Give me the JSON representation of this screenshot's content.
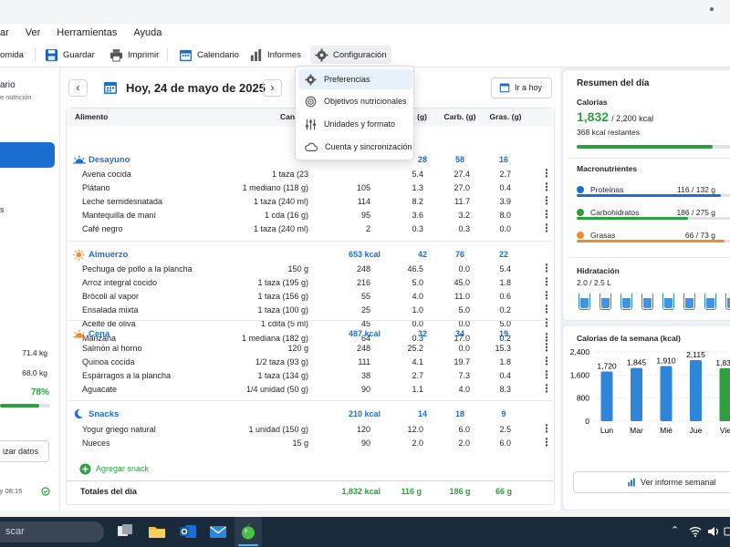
{
  "menu": {
    "archivo": "ar",
    "ver": "Ver",
    "herramientas": "Herramientas",
    "ayuda": "Ayuda"
  },
  "toolbar": {
    "comida": "omida",
    "guardar": "Guardar",
    "imprimir": "Imprimir",
    "calendario": "Calendario",
    "informes": "Informes",
    "configuracion": "Configuración"
  },
  "dropdown": [
    "Preferencias",
    "Objetivos nutricionales",
    "Unidades y formato",
    "Cuenta y sincronización"
  ],
  "sidebar": {
    "title": "ario",
    "subtitle": "e nutrición",
    "letter": "s",
    "w1": "71.4 kg",
    "w2": "68.0 kg",
    "progress_pct": "78%",
    "progress": 0.78,
    "sync_btn": "izar datos",
    "last_sync": "ación: Hoy 08:15"
  },
  "date_nav": {
    "date": "Hoy, 24 de mayo de 2025",
    "today_btn": "Ir a hoy"
  },
  "table": {
    "headers": [
      "Alimento",
      "Can",
      ". (g)",
      "Carb. (g)",
      "Gras. (g)"
    ],
    "meals": [
      {
        "name": "Desayuno",
        "kcal": "",
        "p": "28",
        "c": "58",
        "g": "16",
        "items": [
          {
            "food": "Avena cocida",
            "qty": "1 taza (23",
            "kcal": "",
            "p": "5.4",
            "c": "27.4",
            "g": "2.7"
          },
          {
            "food": "Plátano",
            "qty": "1 mediano (118 g)",
            "kcal": "105",
            "p": "1.3",
            "c": "27.0",
            "g": "0.4"
          },
          {
            "food": "Leche semidesnatada",
            "qty": "1 taza (240 ml)",
            "kcal": "114",
            "p": "8.2",
            "c": "11.7",
            "g": "3.9"
          },
          {
            "food": "Mantequilla de maní",
            "qty": "1 cda (16 g)",
            "kcal": "95",
            "p": "3.6",
            "c": "3.2",
            "g": "8.0"
          },
          {
            "food": "Café negro",
            "qty": "1 taza (240 ml)",
            "kcal": "2",
            "p": "0.3",
            "c": "0.3",
            "g": "0.0"
          }
        ]
      },
      {
        "name": "Almuerzo",
        "kcal": "653 kcal",
        "p": "42",
        "c": "76",
        "g": "22",
        "items": [
          {
            "food": "Pechuga de pollo a la plancha",
            "qty": "150 g",
            "kcal": "248",
            "p": "46.5",
            "c": "0.0",
            "g": "5.4"
          },
          {
            "food": "Arroz integral cocido",
            "qty": "1 taza (195 g)",
            "kcal": "216",
            "p": "5.0",
            "c": "45.0",
            "g": "1.8"
          },
          {
            "food": "Brócoli al vapor",
            "qty": "1 taza (156 g)",
            "kcal": "55",
            "p": "4.0",
            "c": "11.0",
            "g": "0.6"
          },
          {
            "food": "Ensalada mixta",
            "qty": "1 taza (100 g)",
            "kcal": "25",
            "p": "1.0",
            "c": "5.0",
            "g": "0.2"
          },
          {
            "food": "Aceite de oliva",
            "qty": "1 cdita (5 ml)",
            "kcal": "45",
            "p": "0.0",
            "c": "0.0",
            "g": "5.0"
          },
          {
            "food": "Manzana",
            "qty": "1 mediana (182 g)",
            "kcal": "64",
            "p": "0.3",
            "c": "17.0",
            "g": "0.2"
          }
        ]
      },
      {
        "name": "Cena",
        "kcal": "487 kcal",
        "p": "32",
        "c": "34",
        "g": "19",
        "items": [
          {
            "food": "Salmón al horno",
            "qty": "120 g",
            "kcal": "248",
            "p": "25.2",
            "c": "0.0",
            "g": "15.3"
          },
          {
            "food": "Quinoa cocida",
            "qty": "1/2 taza (93 g)",
            "kcal": "111",
            "p": "4.1",
            "c": "19.7",
            "g": "1.8"
          },
          {
            "food": "Espárragos a la plancha",
            "qty": "1 taza (134 g)",
            "kcal": "38",
            "p": "2.7",
            "c": "7.3",
            "g": "0.4"
          },
          {
            "food": "Aguacate",
            "qty": "1/4 unidad (50 g)",
            "kcal": "90",
            "p": "1.1",
            "c": "4.0",
            "g": "8.3"
          }
        ]
      },
      {
        "name": "Snacks",
        "kcal": "210 kcal",
        "p": "14",
        "c": "18",
        "g": "9",
        "items": [
          {
            "food": "Yogur griego natural",
            "qty": "1 unidad (150 g)",
            "kcal": "120",
            "p": "12.0",
            "c": "6.0",
            "g": "2.5"
          },
          {
            "food": "Nueces",
            "qty": "15 g",
            "kcal": "90",
            "p": "2.0",
            "c": "2.0",
            "g": "6.0"
          }
        ]
      }
    ],
    "add_snack": "Agregar snack",
    "totals": {
      "label": "Totales del día",
      "kcal": "1,832 kcal",
      "p": "116 g",
      "c": "186 g",
      "g": "66 g"
    }
  },
  "summary": {
    "title": "Resumen del día",
    "cal_label": "Calorías",
    "cal_value": "1,832",
    "cal_goal": "/ 2,200 kcal",
    "cal_remaining": "368 kcal restantes",
    "cal_fraction": 0.833,
    "macros_title": "Macronutrientes",
    "macros": [
      {
        "name": "Proteínas",
        "value": "116 / 132 g",
        "color": "#1c6fd1",
        "fraction": 0.88
      },
      {
        "name": "Carbohidratos",
        "value": "186 / 275 g",
        "color": "#2e9f3e",
        "fraction": 0.68
      },
      {
        "name": "Grasas",
        "value": "66 / 73 g",
        "color": "#f08c2a",
        "fraction": 0.9
      }
    ],
    "hydration_title": "Hidratación",
    "hydration_value": "2.0 / 2.5 L",
    "weekly_btn": "Ver informe semanal"
  },
  "chart_data": {
    "type": "bar",
    "title": "Calorías de la semana (kcal)",
    "categories": [
      "Lun",
      "Mar",
      "Mié",
      "Jue",
      "Vie"
    ],
    "values": [
      1720,
      1845,
      1910,
      2115,
      1832
    ],
    "value_labels": [
      "1,720",
      "1,845",
      "1,910",
      "2,115",
      "1,832"
    ],
    "ylim": [
      0,
      2400
    ],
    "yticks": [
      "0",
      "800",
      "1,600",
      "2,400"
    ],
    "colors": [
      "#2f86d8",
      "#2f86d8",
      "#2f86d8",
      "#2f86d8",
      "#2e9f3e"
    ]
  },
  "taskbar": {
    "search": "scar"
  }
}
